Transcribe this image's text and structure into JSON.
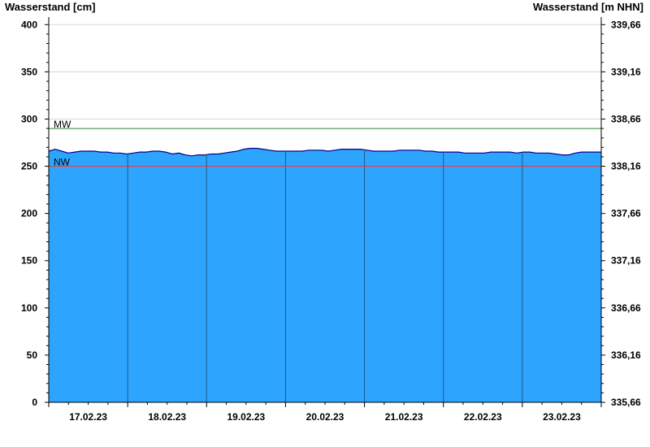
{
  "chart_data": {
    "type": "area",
    "ylabel_left": "Wasserstand [cm]",
    "ylabel_right": "Wasserstand [m NHN]",
    "ylim": [
      0,
      408
    ],
    "y_ticks_left": [
      {
        "value": 0,
        "label": "0"
      },
      {
        "value": 50,
        "label": "50"
      },
      {
        "value": 100,
        "label": "100"
      },
      {
        "value": 150,
        "label": "150"
      },
      {
        "value": 200,
        "label": "200"
      },
      {
        "value": 250,
        "label": "250"
      },
      {
        "value": 300,
        "label": "300"
      },
      {
        "value": 350,
        "label": "350"
      },
      {
        "value": 400,
        "label": "400"
      }
    ],
    "y_ticks_right": [
      {
        "value": 0,
        "label": "335,66"
      },
      {
        "value": 50,
        "label": "336,16"
      },
      {
        "value": 100,
        "label": "336,66"
      },
      {
        "value": 150,
        "label": "337,16"
      },
      {
        "value": 200,
        "label": "337,66"
      },
      {
        "value": 250,
        "label": "338,16"
      },
      {
        "value": 300,
        "label": "338,66"
      },
      {
        "value": 350,
        "label": "339,16"
      },
      {
        "value": 400,
        "label": "339,66"
      }
    ],
    "x_range_days": [
      0,
      7
    ],
    "x_day_labels": [
      "17.02.23",
      "18.02.23",
      "19.02.23",
      "20.02.23",
      "21.02.23",
      "22.02.23",
      "23.02.23"
    ],
    "reference_lines": [
      {
        "label": "MW",
        "value": 290,
        "color": "#2e7d32"
      },
      {
        "label": "NW",
        "value": 250,
        "color": "#e53935"
      }
    ],
    "series": [
      {
        "values": [
          266,
          268,
          266,
          264,
          265,
          266,
          266,
          266,
          265,
          265,
          264,
          264,
          263,
          264,
          265,
          265,
          266,
          266,
          265,
          263,
          264,
          262,
          261,
          262,
          262,
          263,
          263,
          264,
          265,
          266,
          268,
          269,
          269,
          268,
          267,
          266,
          266,
          266,
          266,
          266,
          267,
          267,
          267,
          266,
          267,
          268,
          268,
          268,
          268,
          267,
          266,
          266,
          266,
          266,
          267,
          267,
          267,
          267,
          266,
          266,
          265,
          265,
          265,
          265,
          264,
          264,
          264,
          264,
          265,
          265,
          265,
          265,
          264,
          265,
          265,
          264,
          264,
          264,
          263,
          262,
          262,
          264,
          265,
          265,
          265,
          265
        ],
        "color": "#2da5ff",
        "line_color": "#00008b"
      }
    ]
  }
}
